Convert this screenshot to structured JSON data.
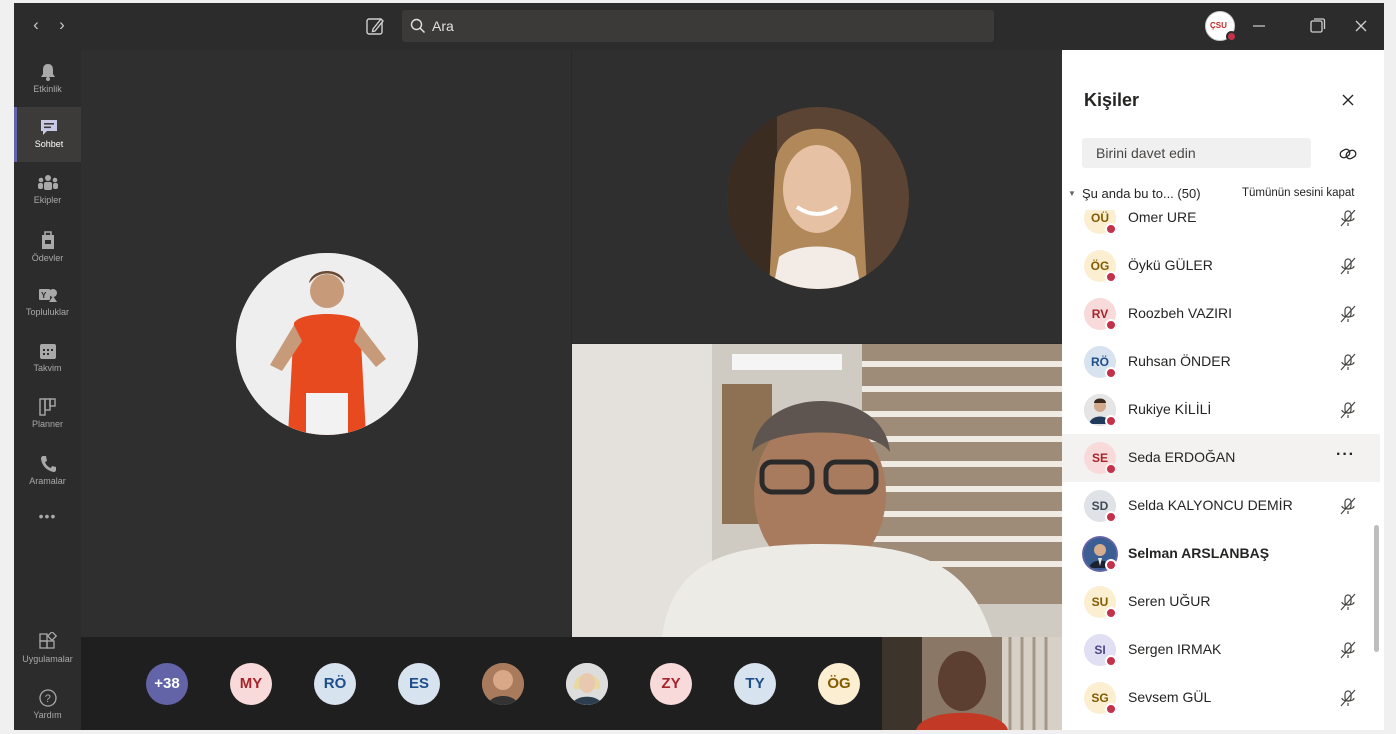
{
  "search": {
    "placeholder": "Ara"
  },
  "profile": {
    "logo_text": "ÇSU"
  },
  "rail": {
    "items": [
      {
        "label": "Etkinlik",
        "icon": "bell-icon"
      },
      {
        "label": "Sohbet",
        "icon": "chat-icon",
        "active": true
      },
      {
        "label": "Ekipler",
        "icon": "teams-icon"
      },
      {
        "label": "Ödevler",
        "icon": "assignments-icon"
      },
      {
        "label": "Topluluklar",
        "icon": "communities-icon"
      },
      {
        "label": "Takvim",
        "icon": "calendar-icon"
      },
      {
        "label": "Planner",
        "icon": "planner-icon"
      },
      {
        "label": "Aramalar",
        "icon": "phone-icon"
      }
    ],
    "more": "•••",
    "apps_label": "Uygulamalar",
    "help_label": "Yardım"
  },
  "strip": {
    "overflow": "+38",
    "chips": [
      "MY",
      "RÖ",
      "ES",
      "ZY",
      "TY",
      "ÖG"
    ]
  },
  "panel": {
    "title": "Kişiler",
    "invite_placeholder": "Birini davet edin",
    "section_label": "Şu anda bu to...  (50)",
    "mute_all": "Tümünün sesini kapat",
    "people": [
      {
        "initials": "OÜ",
        "name": "Omer URE",
        "bg": "#fbeed1",
        "fg": "#835b00"
      },
      {
        "initials": "ÖG",
        "name": "Öykü GÜLER",
        "bg": "#fbeed1",
        "fg": "#835b00"
      },
      {
        "initials": "RV",
        "name": "Roozbeh VAZIRI",
        "bg": "#f9dada",
        "fg": "#a4262c"
      },
      {
        "initials": "RÖ",
        "name": "Ruhsan ÖNDER",
        "bg": "#d8e3f0",
        "fg": "#1d4e89"
      },
      {
        "initials": "",
        "name": "Rukiye KİLİLİ",
        "bg": "#cfcfcf",
        "fg": "#333"
      },
      {
        "initials": "SE",
        "name": "Seda ERDOĞAN",
        "bg": "#f9dada",
        "fg": "#a4262c"
      },
      {
        "initials": "SD",
        "name": "Selda KALYONCU DEMİR",
        "bg": "#dfe2e6",
        "fg": "#3f4b57"
      },
      {
        "initials": "",
        "name": "Selman ARSLANBAŞ",
        "bg": "#2f4f7f",
        "fg": "#fff"
      },
      {
        "initials": "SU",
        "name": "Seren UĞUR",
        "bg": "#fbeed1",
        "fg": "#835b00"
      },
      {
        "initials": "SI",
        "name": "Sergen IRMAK",
        "bg": "#e1dff3",
        "fg": "#4b4785"
      },
      {
        "initials": "SG",
        "name": "Sevsem GÜL",
        "bg": "#fbeed1",
        "fg": "#835b00"
      }
    ],
    "more_options": "···"
  },
  "colors": {
    "accent": "#6264a7",
    "status_busy": "#c4314b"
  }
}
